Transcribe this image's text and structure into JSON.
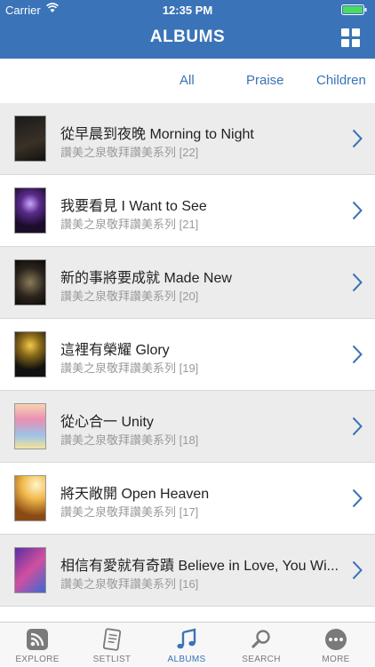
{
  "status": {
    "carrier": "Carrier",
    "time": "12:35 PM"
  },
  "header": {
    "title": "ALBUMS"
  },
  "tabs": [
    {
      "label": "All"
    },
    {
      "label": "Praise"
    },
    {
      "label": "Children"
    }
  ],
  "albums": [
    {
      "title": "從早晨到夜晚 Morning to Night",
      "subtitle": "讚美之泉敬拜讚美系列 [22]"
    },
    {
      "title": "我要看見 I Want to See",
      "subtitle": "讚美之泉敬拜讚美系列 [21]"
    },
    {
      "title": "新的事將要成就 Made New",
      "subtitle": "讚美之泉敬拜讚美系列 [20]"
    },
    {
      "title": "這裡有榮耀 Glory",
      "subtitle": "讚美之泉敬拜讚美系列 [19]"
    },
    {
      "title": "從心合一 Unity",
      "subtitle": "讚美之泉敬拜讚美系列 [18]"
    },
    {
      "title": "將天敞開 Open Heaven",
      "subtitle": "讚美之泉敬拜讚美系列 [17]"
    },
    {
      "title": "相信有愛就有奇蹟 Believe in Love, You Wi...",
      "subtitle": "讚美之泉敬拜讚美系列 [16]"
    }
  ],
  "tabbar": [
    {
      "label": "EXPLORE",
      "icon": "rss-icon"
    },
    {
      "label": "SETLIST",
      "icon": "setlist-icon"
    },
    {
      "label": "ALBUMS",
      "icon": "music-note-icon"
    },
    {
      "label": "SEARCH",
      "icon": "search-icon"
    },
    {
      "label": "MORE",
      "icon": "more-icon"
    }
  ],
  "colors": {
    "accent": "#3a73b8",
    "row_shade": "#ececec"
  }
}
